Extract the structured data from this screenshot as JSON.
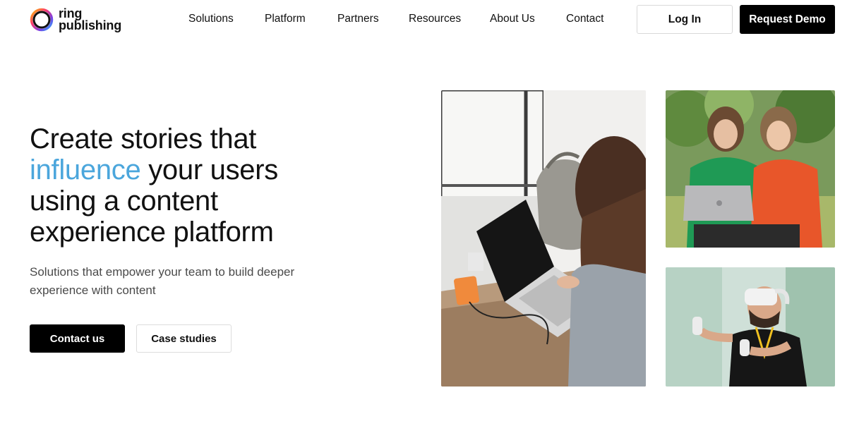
{
  "brand": {
    "logo_line1": "ring",
    "logo_line2": "publishing",
    "logo_icon": "ring-logo-icon"
  },
  "nav": {
    "items": [
      {
        "label": "Solutions"
      },
      {
        "label": "Platform"
      },
      {
        "label": "Partners"
      },
      {
        "label": "Resources"
      },
      {
        "label": "About Us"
      },
      {
        "label": "Contact"
      }
    ],
    "login_label": "Log In",
    "demo_label": "Request Demo"
  },
  "hero": {
    "title_before": "Create stories that",
    "title_accent": "influence",
    "title_after_accent": " your users",
    "title_line3": "using a content",
    "title_line4": "experience platform",
    "subtitle": "Solutions that empower your team to build deeper experience with content",
    "contact_label": "Contact us",
    "case_label": "Case studies"
  },
  "colors": {
    "accent": "#4ba6dc",
    "primary_button": "#000000",
    "text": "#111111"
  }
}
